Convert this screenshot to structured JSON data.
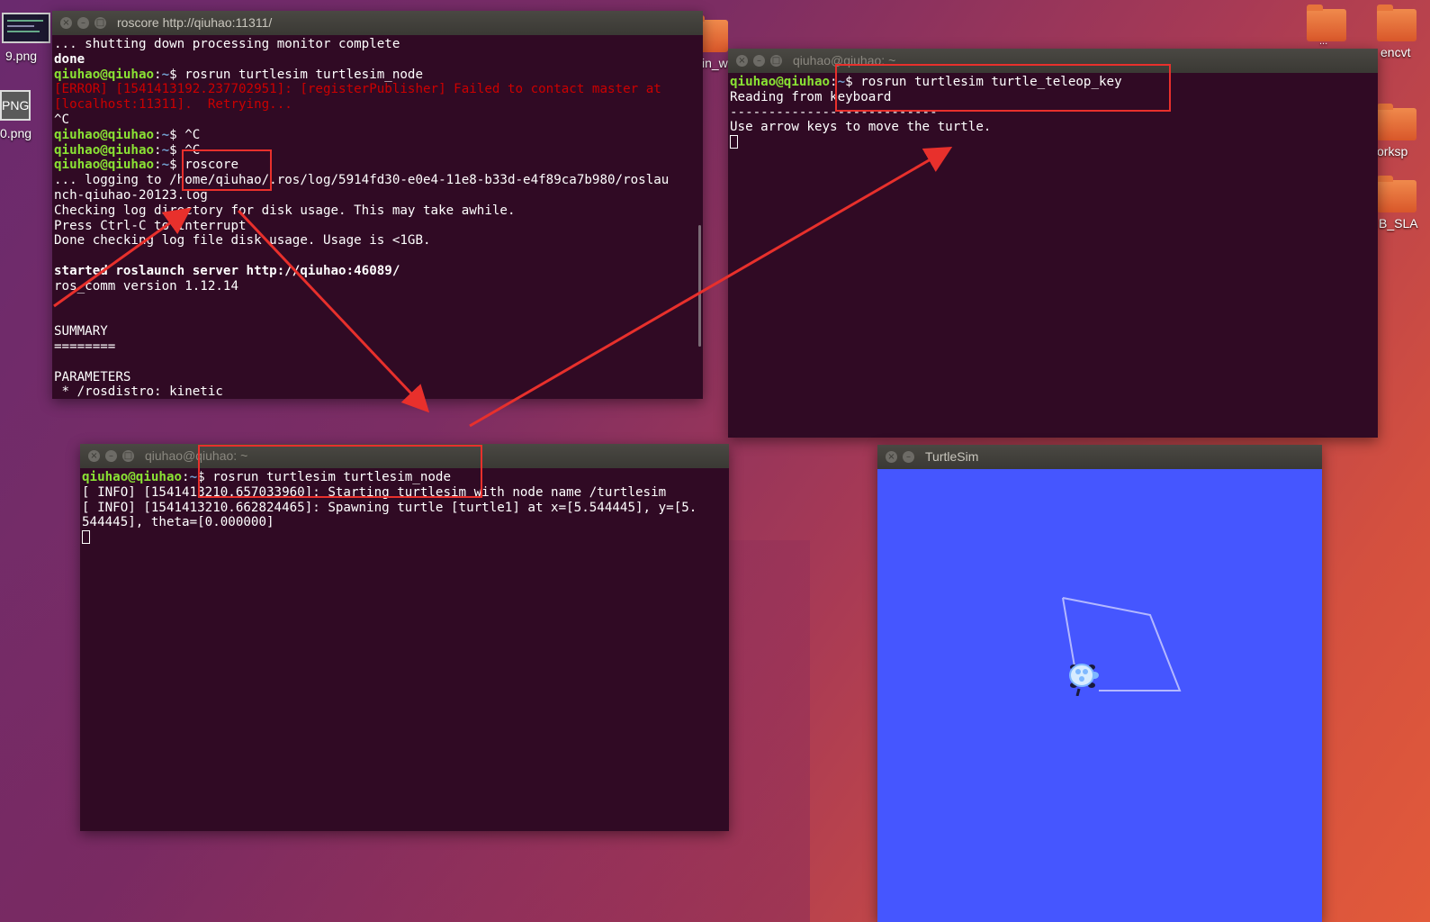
{
  "desktop": {
    "left_icons": [
      {
        "label": "9.png",
        "icon": "image-thumbnail-icon"
      },
      {
        "badge": "PNG",
        "label": "0.png",
        "icon": "png-file-icon"
      }
    ],
    "right_icons": [
      {
        "label": "...",
        "icon": "folder-icon"
      },
      {
        "label": "encvt",
        "icon": "folder-icon"
      },
      {
        "label": "orksp",
        "icon": "folder-icon"
      },
      {
        "label": "B_SLA",
        "icon": "folder-icon"
      },
      {
        "label": "in_w",
        "icon": "folder-icon"
      }
    ]
  },
  "windows": {
    "roscore": {
      "title": "roscore http://qiuhao:11311/",
      "lines": [
        {
          "segments": [
            {
              "t": "... shutting down processing monitor complete"
            }
          ]
        },
        {
          "segments": [
            {
              "t": "done",
              "c": "bold"
            }
          ]
        },
        {
          "segments": [
            {
              "t": "qiuhao@qiuhao",
              "c": "g"
            },
            {
              "t": ":"
            },
            {
              "t": "~",
              "c": "b"
            },
            {
              "t": "$ rosrun turtlesim turtlesim_node"
            }
          ]
        },
        {
          "segments": [
            {
              "t": "[ERROR] [1541413192.237702951]: [registerPublisher] Failed to contact master at",
              "c": "r"
            }
          ]
        },
        {
          "segments": [
            {
              "t": "[localhost:11311].  Retrying...",
              "c": "r"
            }
          ]
        },
        {
          "segments": [
            {
              "t": "^C"
            }
          ]
        },
        {
          "segments": [
            {
              "t": "qiuhao@qiuhao",
              "c": "g"
            },
            {
              "t": ":"
            },
            {
              "t": "~",
              "c": "b"
            },
            {
              "t": "$ ^C"
            }
          ]
        },
        {
          "segments": [
            {
              "t": "qiuhao@qiuhao",
              "c": "g"
            },
            {
              "t": ":"
            },
            {
              "t": "~",
              "c": "b"
            },
            {
              "t": "$ ^C"
            }
          ]
        },
        {
          "segments": [
            {
              "t": "qiuhao@qiuhao",
              "c": "g"
            },
            {
              "t": ":"
            },
            {
              "t": "~",
              "c": "b"
            },
            {
              "t": "$ roscore"
            }
          ]
        },
        {
          "segments": [
            {
              "t": "... logging to /home/qiuhao/.ros/log/5914fd30-e0e4-11e8-b33d-e4f89ca7b980/roslau"
            }
          ]
        },
        {
          "segments": [
            {
              "t": "nch-qiuhao-20123.log"
            }
          ]
        },
        {
          "segments": [
            {
              "t": "Checking log directory for disk usage. This may take awhile."
            }
          ]
        },
        {
          "segments": [
            {
              "t": "Press Ctrl-C to interrupt"
            }
          ]
        },
        {
          "segments": [
            {
              "t": "Done checking log file disk usage. Usage is <1GB."
            }
          ]
        },
        {
          "segments": [
            {
              "t": ""
            }
          ]
        },
        {
          "segments": [
            {
              "t": "started roslaunch server http://qiuhao:46089/",
              "c": "bold"
            }
          ]
        },
        {
          "segments": [
            {
              "t": "ros_comm version 1.12.14"
            }
          ]
        },
        {
          "segments": [
            {
              "t": ""
            }
          ]
        },
        {
          "segments": [
            {
              "t": ""
            }
          ]
        },
        {
          "segments": [
            {
              "t": "SUMMARY"
            }
          ]
        },
        {
          "segments": [
            {
              "t": "========"
            }
          ]
        },
        {
          "segments": [
            {
              "t": ""
            }
          ]
        },
        {
          "segments": [
            {
              "t": "PARAMETERS"
            }
          ]
        },
        {
          "segments": [
            {
              "t": " * /rosdistro: kinetic"
            }
          ]
        }
      ]
    },
    "teleop": {
      "title": "qiuhao@qiuhao: ~",
      "lines": [
        {
          "segments": [
            {
              "t": "qiuhao@qiuhao",
              "c": "g"
            },
            {
              "t": ":"
            },
            {
              "t": "~",
              "c": "b"
            },
            {
              "t": "$ rosrun turtlesim turtle_teleop_key"
            }
          ]
        },
        {
          "segments": [
            {
              "t": "Reading from keyboard"
            }
          ]
        },
        {
          "segments": [
            {
              "t": "---------------------------"
            }
          ]
        },
        {
          "segments": [
            {
              "t": "Use arrow keys to move the turtle."
            }
          ]
        }
      ]
    },
    "node": {
      "title": "qiuhao@qiuhao: ~",
      "lines": [
        {
          "segments": [
            {
              "t": "qiuhao@qiuhao",
              "c": "g"
            },
            {
              "t": ":"
            },
            {
              "t": "~",
              "c": "b"
            },
            {
              "t": "$ rosrun turtlesim turtlesim_node"
            }
          ]
        },
        {
          "segments": [
            {
              "t": "[ INFO] [1541413210.657033960]: Starting turtlesim with node name /turtlesim"
            }
          ]
        },
        {
          "segments": [
            {
              "t": "[ INFO] [1541413210.662824465]: Spawning turtle [turtle1] at x=[5.544445], y=[5."
            }
          ]
        },
        {
          "segments": [
            {
              "t": "544445], theta=[0.000000]"
            }
          ]
        }
      ]
    },
    "turtlesim": {
      "title": "TurtleSim",
      "canvas_color": "#4556ff",
      "trail_color": "#b3b8ff"
    }
  },
  "colors": {
    "terminal_bg": "#300a24",
    "prompt_user": "#8ae234",
    "prompt_path": "#729fcf",
    "error_text": "#cc0000",
    "annotation_red": "#e8302c"
  }
}
